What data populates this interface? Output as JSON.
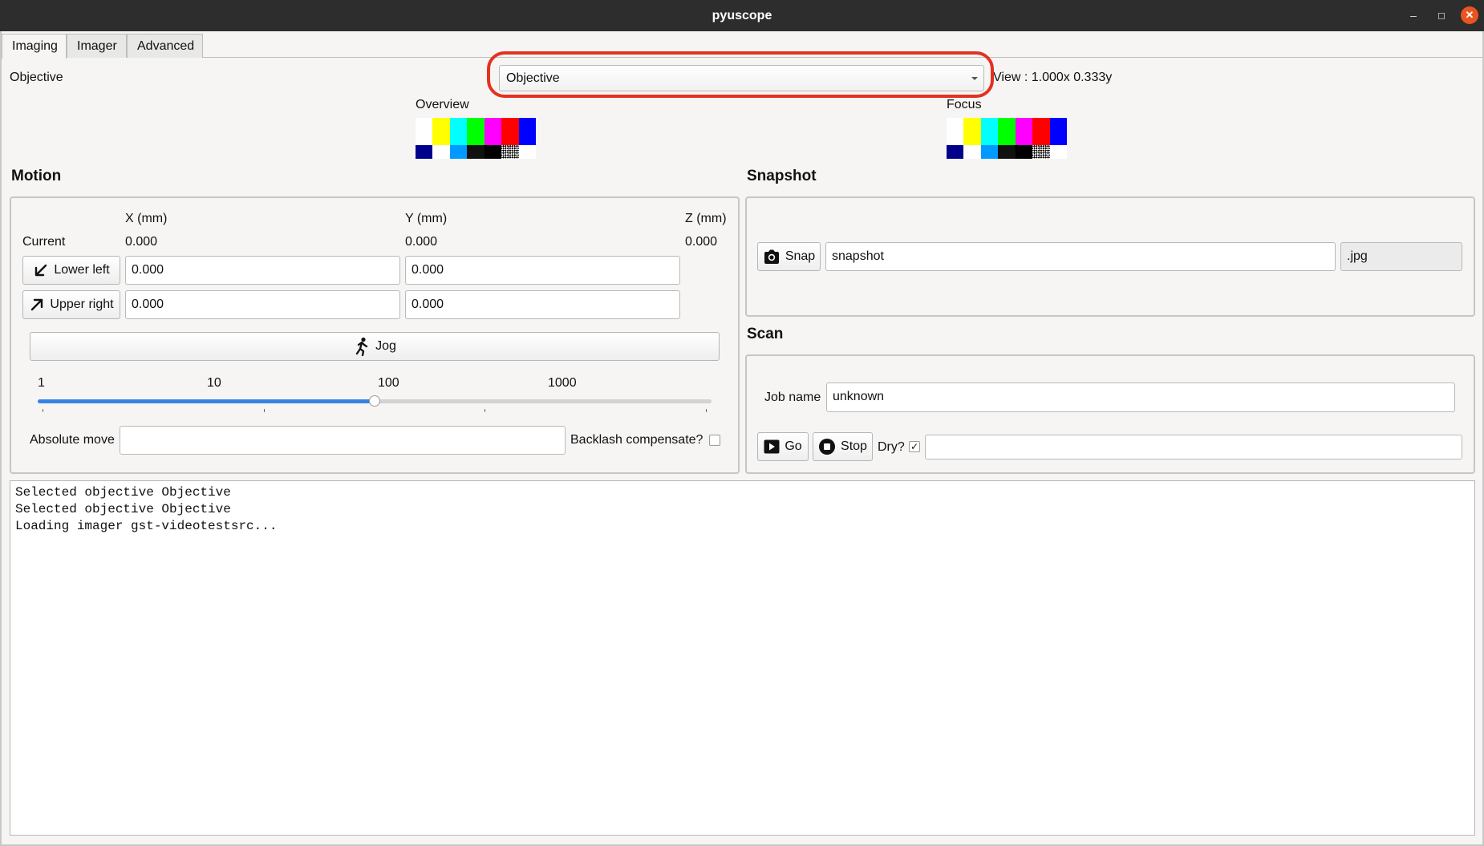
{
  "window": {
    "title": "pyuscope"
  },
  "tabs": [
    {
      "label": "Imaging",
      "active": true
    },
    {
      "label": "Imager",
      "active": false
    },
    {
      "label": "Advanced",
      "active": false
    }
  ],
  "objective": {
    "label": "Objective",
    "selected": "Objective",
    "view_text": "View : 1.000x 0.333y"
  },
  "previews": {
    "overview_label": "Overview",
    "focus_label": "Focus"
  },
  "motion": {
    "title": "Motion",
    "headers": {
      "x": "X (mm)",
      "y": "Y (mm)",
      "z": "Z (mm)"
    },
    "current_label": "Current",
    "current": {
      "x": "0.000",
      "y": "0.000",
      "z": "0.000"
    },
    "lower_left_label": "Lower left",
    "lower_left": {
      "x": "0.000",
      "y": "0.000"
    },
    "upper_right_label": "Upper right",
    "upper_right": {
      "x": "0.000",
      "y": "0.000"
    },
    "jog_label": "Jog",
    "slider_labels": [
      "1",
      "10",
      "100",
      "1000"
    ],
    "slider_fraction": 0.5,
    "absolute_move_label": "Absolute move",
    "absolute_move_value": "",
    "backlash_label": "Backlash compensate?",
    "backlash_checked": false
  },
  "snapshot": {
    "title": "Snapshot",
    "snap_label": "Snap",
    "filename": "snapshot",
    "extension": ".jpg"
  },
  "scan": {
    "title": "Scan",
    "job_name_label": "Job name",
    "job_name": "unknown",
    "go_label": "Go",
    "stop_label": "Stop",
    "dry_label": "Dry?",
    "dry_checked": true,
    "status": ""
  },
  "log": {
    "lines": [
      "Selected objective Objective",
      "Selected objective Objective",
      "Loading imager gst-videotestsrc..."
    ]
  },
  "colors": {
    "highlight": "#e5311f",
    "slider_accent": "#3584e4",
    "titlebar": "#2d2d2d",
    "close_button": "#e95420"
  }
}
